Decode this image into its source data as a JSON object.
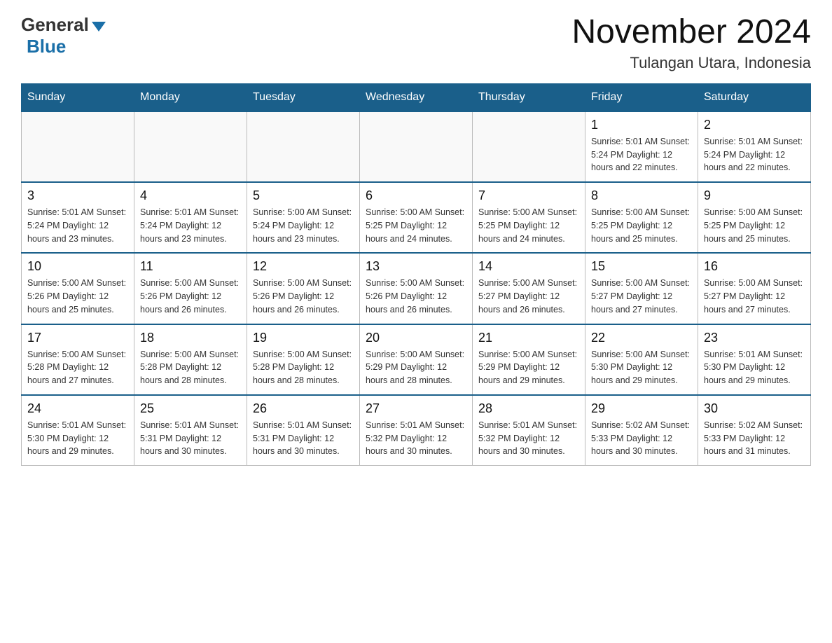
{
  "header": {
    "logo_general": "General",
    "logo_blue": "Blue",
    "month_title": "November 2024",
    "location": "Tulangan Utara, Indonesia"
  },
  "weekdays": [
    "Sunday",
    "Monday",
    "Tuesday",
    "Wednesday",
    "Thursday",
    "Friday",
    "Saturday"
  ],
  "weeks": [
    [
      {
        "day": "",
        "info": ""
      },
      {
        "day": "",
        "info": ""
      },
      {
        "day": "",
        "info": ""
      },
      {
        "day": "",
        "info": ""
      },
      {
        "day": "",
        "info": ""
      },
      {
        "day": "1",
        "info": "Sunrise: 5:01 AM\nSunset: 5:24 PM\nDaylight: 12 hours\nand 22 minutes."
      },
      {
        "day": "2",
        "info": "Sunrise: 5:01 AM\nSunset: 5:24 PM\nDaylight: 12 hours\nand 22 minutes."
      }
    ],
    [
      {
        "day": "3",
        "info": "Sunrise: 5:01 AM\nSunset: 5:24 PM\nDaylight: 12 hours\nand 23 minutes."
      },
      {
        "day": "4",
        "info": "Sunrise: 5:01 AM\nSunset: 5:24 PM\nDaylight: 12 hours\nand 23 minutes."
      },
      {
        "day": "5",
        "info": "Sunrise: 5:00 AM\nSunset: 5:24 PM\nDaylight: 12 hours\nand 23 minutes."
      },
      {
        "day": "6",
        "info": "Sunrise: 5:00 AM\nSunset: 5:25 PM\nDaylight: 12 hours\nand 24 minutes."
      },
      {
        "day": "7",
        "info": "Sunrise: 5:00 AM\nSunset: 5:25 PM\nDaylight: 12 hours\nand 24 minutes."
      },
      {
        "day": "8",
        "info": "Sunrise: 5:00 AM\nSunset: 5:25 PM\nDaylight: 12 hours\nand 25 minutes."
      },
      {
        "day": "9",
        "info": "Sunrise: 5:00 AM\nSunset: 5:25 PM\nDaylight: 12 hours\nand 25 minutes."
      }
    ],
    [
      {
        "day": "10",
        "info": "Sunrise: 5:00 AM\nSunset: 5:26 PM\nDaylight: 12 hours\nand 25 minutes."
      },
      {
        "day": "11",
        "info": "Sunrise: 5:00 AM\nSunset: 5:26 PM\nDaylight: 12 hours\nand 26 minutes."
      },
      {
        "day": "12",
        "info": "Sunrise: 5:00 AM\nSunset: 5:26 PM\nDaylight: 12 hours\nand 26 minutes."
      },
      {
        "day": "13",
        "info": "Sunrise: 5:00 AM\nSunset: 5:26 PM\nDaylight: 12 hours\nand 26 minutes."
      },
      {
        "day": "14",
        "info": "Sunrise: 5:00 AM\nSunset: 5:27 PM\nDaylight: 12 hours\nand 26 minutes."
      },
      {
        "day": "15",
        "info": "Sunrise: 5:00 AM\nSunset: 5:27 PM\nDaylight: 12 hours\nand 27 minutes."
      },
      {
        "day": "16",
        "info": "Sunrise: 5:00 AM\nSunset: 5:27 PM\nDaylight: 12 hours\nand 27 minutes."
      }
    ],
    [
      {
        "day": "17",
        "info": "Sunrise: 5:00 AM\nSunset: 5:28 PM\nDaylight: 12 hours\nand 27 minutes."
      },
      {
        "day": "18",
        "info": "Sunrise: 5:00 AM\nSunset: 5:28 PM\nDaylight: 12 hours\nand 28 minutes."
      },
      {
        "day": "19",
        "info": "Sunrise: 5:00 AM\nSunset: 5:28 PM\nDaylight: 12 hours\nand 28 minutes."
      },
      {
        "day": "20",
        "info": "Sunrise: 5:00 AM\nSunset: 5:29 PM\nDaylight: 12 hours\nand 28 minutes."
      },
      {
        "day": "21",
        "info": "Sunrise: 5:00 AM\nSunset: 5:29 PM\nDaylight: 12 hours\nand 29 minutes."
      },
      {
        "day": "22",
        "info": "Sunrise: 5:00 AM\nSunset: 5:30 PM\nDaylight: 12 hours\nand 29 minutes."
      },
      {
        "day": "23",
        "info": "Sunrise: 5:01 AM\nSunset: 5:30 PM\nDaylight: 12 hours\nand 29 minutes."
      }
    ],
    [
      {
        "day": "24",
        "info": "Sunrise: 5:01 AM\nSunset: 5:30 PM\nDaylight: 12 hours\nand 29 minutes."
      },
      {
        "day": "25",
        "info": "Sunrise: 5:01 AM\nSunset: 5:31 PM\nDaylight: 12 hours\nand 30 minutes."
      },
      {
        "day": "26",
        "info": "Sunrise: 5:01 AM\nSunset: 5:31 PM\nDaylight: 12 hours\nand 30 minutes."
      },
      {
        "day": "27",
        "info": "Sunrise: 5:01 AM\nSunset: 5:32 PM\nDaylight: 12 hours\nand 30 minutes."
      },
      {
        "day": "28",
        "info": "Sunrise: 5:01 AM\nSunset: 5:32 PM\nDaylight: 12 hours\nand 30 minutes."
      },
      {
        "day": "29",
        "info": "Sunrise: 5:02 AM\nSunset: 5:33 PM\nDaylight: 12 hours\nand 30 minutes."
      },
      {
        "day": "30",
        "info": "Sunrise: 5:02 AM\nSunset: 5:33 PM\nDaylight: 12 hours\nand 31 minutes."
      }
    ]
  ]
}
